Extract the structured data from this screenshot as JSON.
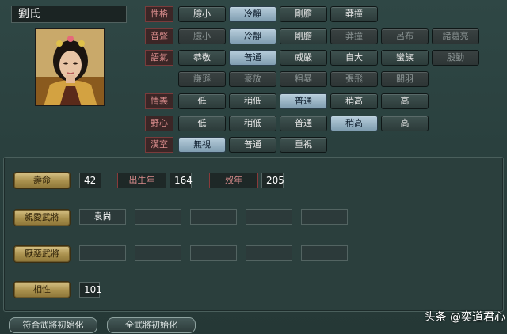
{
  "character": {
    "name": "劉氏"
  },
  "personality": {
    "label": "性格",
    "options": [
      "臆小",
      "冷靜",
      "剛膽",
      "莽撞"
    ],
    "selected": "冷靜"
  },
  "voice": {
    "label": "音聲",
    "options": [
      "臆小",
      "冷靜",
      "剛膽",
      "莽撞",
      "呂布",
      "諸葛亮"
    ],
    "selected": "冷靜"
  },
  "tone": {
    "label": "語氣",
    "row1": [
      "恭敬",
      "普通",
      "威嚴",
      "自大",
      "蠻族",
      "殷勤"
    ],
    "row2": [
      "謙遜",
      "豪放",
      "粗暴",
      "張飛",
      "關羽"
    ],
    "selected": "普通"
  },
  "loyalty": {
    "label": "情義",
    "options": [
      "低",
      "稍低",
      "普通",
      "稍高",
      "高"
    ],
    "selected": "普通"
  },
  "ambition": {
    "label": "野心",
    "options": [
      "低",
      "稍低",
      "普通",
      "稍高",
      "高"
    ],
    "selected": "稍高"
  },
  "han": {
    "label": "漢室",
    "options": [
      "無視",
      "普通",
      "重視"
    ],
    "selected": "無視"
  },
  "lifespan": {
    "button": "壽命",
    "value": "42",
    "birth_label": "出生年",
    "birth_value": "164",
    "death_label": "歿年",
    "death_value": "205"
  },
  "liked_generals": {
    "button": "親愛武將",
    "slots": [
      "袁尚",
      "",
      "",
      "",
      ""
    ]
  },
  "disliked_generals": {
    "button": "厭惡武將",
    "slots": [
      "",
      "",
      "",
      "",
      ""
    ]
  },
  "compatibility": {
    "button": "相性",
    "value": "101"
  },
  "bottom": {
    "reset_matching": "符合武將初始化",
    "reset_all": "全武將初始化"
  },
  "watermark": "头条 @奕道君心",
  "colors": {
    "background": "#2f4745",
    "selected_button": "#9bb6c8",
    "gold_button": "#bda766",
    "red_label": "#d98c8c"
  }
}
